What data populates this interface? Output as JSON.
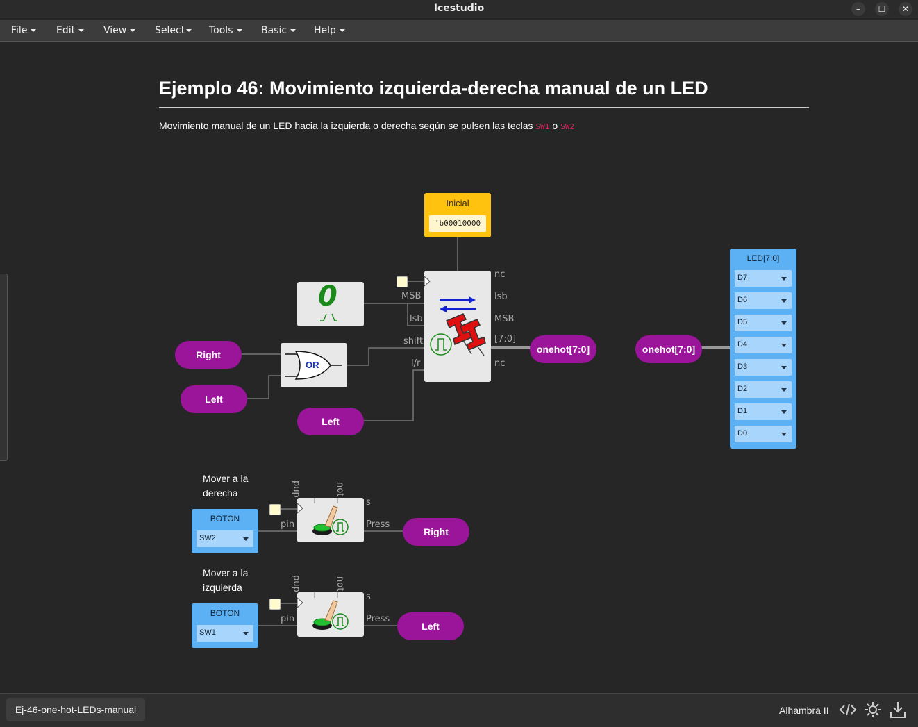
{
  "window": {
    "title": "Icestudio",
    "minimize": "–",
    "maximize": "☐",
    "close": "✕"
  },
  "menu": [
    "File",
    "Edit",
    "View",
    "Select",
    "Tools",
    "Basic",
    "Help"
  ],
  "doc": {
    "heading": "Ejemplo 46: Movimiento izquierda-derecha manual de un LED",
    "description": "Movimiento manual de un LED hacia la izquierda o derecha según se pulsen las teclas",
    "code1": "SW1",
    "conj": "o",
    "code2": "SW2"
  },
  "circuit": {
    "inicial": {
      "title": "Inicial",
      "value": "'b00010000"
    },
    "constant_zero": "0",
    "or_gate": "OR",
    "labels": {
      "right_in": "Right",
      "left_in1": "Left",
      "left_in2": "Left",
      "onehot_out": "onehot[7:0]",
      "onehot_in": "onehot[7:0]",
      "right_out": "Right",
      "left_out": "Left"
    },
    "shifter_ports": {
      "left": [
        "MSB",
        "lsb",
        "shift",
        "l/r"
      ],
      "right": [
        "nc",
        "lsb",
        "MSB",
        "[7:0]",
        "nc"
      ]
    },
    "led_block": {
      "title": "LED[7:0]",
      "pins": [
        "D7",
        "D6",
        "D5",
        "D4",
        "D3",
        "D2",
        "D1",
        "D0"
      ]
    },
    "buttons": [
      {
        "caption": [
          "Mover a la",
          "derecha"
        ],
        "title": "BOTON",
        "pin": "SW2",
        "port_in": "pin",
        "port_out": "Press",
        "top_ports": [
          "pup",
          "not"
        ],
        "s_port": "s"
      },
      {
        "caption": [
          "Mover a la",
          "izquierda"
        ],
        "title": "BOTON",
        "pin": "SW1",
        "port_in": "pin",
        "port_out": "Press",
        "top_ports": [
          "pup",
          "not"
        ],
        "s_port": "s"
      }
    ]
  },
  "status": {
    "file": "Ej-46-one-hot-LEDs-manual",
    "board": "Alhambra II"
  },
  "colors": {
    "label": "#9b159b",
    "io": "#5cb1f5",
    "constant": "#ffc20e",
    "wire": "#777777"
  }
}
